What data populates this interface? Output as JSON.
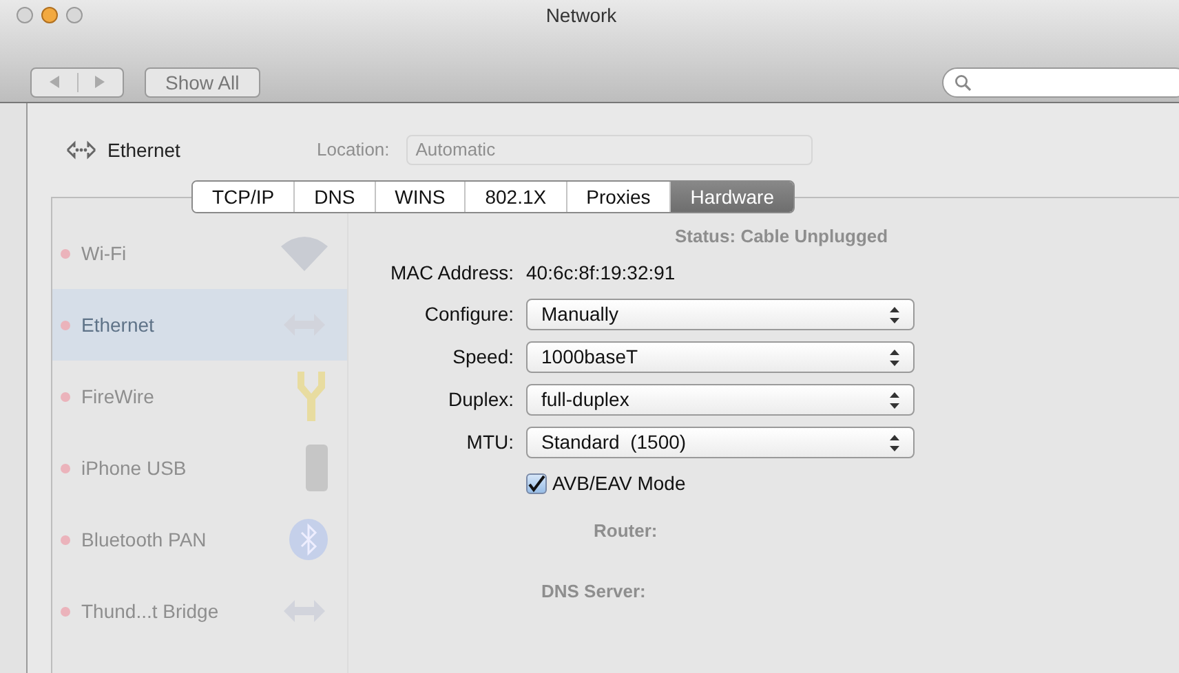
{
  "window": {
    "title": "Network",
    "show_all": "Show All"
  },
  "service": {
    "name": "Ethernet"
  },
  "location": {
    "label": "Location:",
    "value": "Automatic"
  },
  "tabs": [
    {
      "label": "TCP/IP",
      "selected": false
    },
    {
      "label": "DNS",
      "selected": false
    },
    {
      "label": "WINS",
      "selected": false
    },
    {
      "label": "802.1X",
      "selected": false
    },
    {
      "label": "Proxies",
      "selected": false
    },
    {
      "label": "Hardware",
      "selected": true
    }
  ],
  "services": [
    {
      "name": "Wi-Fi",
      "selected": false
    },
    {
      "name": "Ethernet",
      "selected": true
    },
    {
      "name": "FireWire",
      "selected": false
    },
    {
      "name": "iPhone USB",
      "selected": false
    },
    {
      "name": "Bluetooth PAN",
      "selected": false
    },
    {
      "name": "Thund...t Bridge",
      "selected": false
    }
  ],
  "status": {
    "label": "Status:",
    "value": "Cable Unplugged"
  },
  "hardware": {
    "mac_label": "MAC Address:",
    "mac": "40:6c:8f:19:32:91",
    "fields": [
      {
        "label": "Configure:",
        "value": "Manually"
      },
      {
        "label": "Speed:",
        "value": "1000baseT"
      },
      {
        "label": "Duplex:",
        "value": "full-duplex"
      },
      {
        "label": "MTU:",
        "value": "Standard  (1500)"
      }
    ],
    "avb": {
      "label": "AVB/EAV Mode",
      "checked": true
    }
  },
  "background_labels": [
    "Router:",
    "DNS Server:"
  ]
}
